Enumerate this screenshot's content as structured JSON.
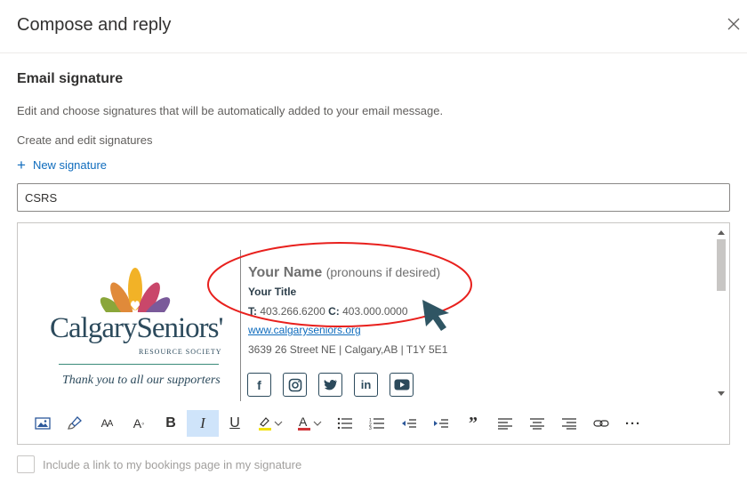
{
  "dialog": {
    "title": "Compose and reply"
  },
  "section": {
    "title": "Email signature",
    "description": "Edit and choose signatures that will be automatically added to your email message.",
    "subheading": "Create and edit signatures",
    "new_signature": "New signature"
  },
  "signature_name": {
    "value": "CSRS"
  },
  "signature": {
    "logo_text": "CalgarySeniors'",
    "logo_sub": "RESOURCE SOCIETY",
    "logo_tagline": "Thank you to all our supporters",
    "name": "Your Name",
    "pronouns": "(pronouns if desired)",
    "title": "Your Title",
    "phone_t_label": "T:",
    "phone_t": "403.266.6200",
    "phone_c_label": "C:",
    "phone_c": "403.000.0000",
    "website": "www.calgaryseniors.org",
    "address": "3639 26 Street NE | Calgary,AB | T1Y 5E1",
    "social": [
      "f",
      "ig",
      "tw",
      "in",
      "yt"
    ]
  },
  "toolbar": {
    "items": [
      "insert-image",
      "format-painter",
      "font-size",
      "superscript",
      "bold",
      "italic",
      "underline",
      "highlight",
      "font-color",
      "bullets",
      "numbering",
      "decrease-indent",
      "increase-indent",
      "quote",
      "align-left",
      "align-center",
      "align-right",
      "link",
      "more"
    ],
    "active": "italic"
  },
  "bookings": {
    "label": "Include a link to my bookings page in my signature",
    "checked": false
  },
  "colors": {
    "accent": "#0f6cbd",
    "annotation": "#e8201d",
    "arrow": "#2f5563"
  }
}
